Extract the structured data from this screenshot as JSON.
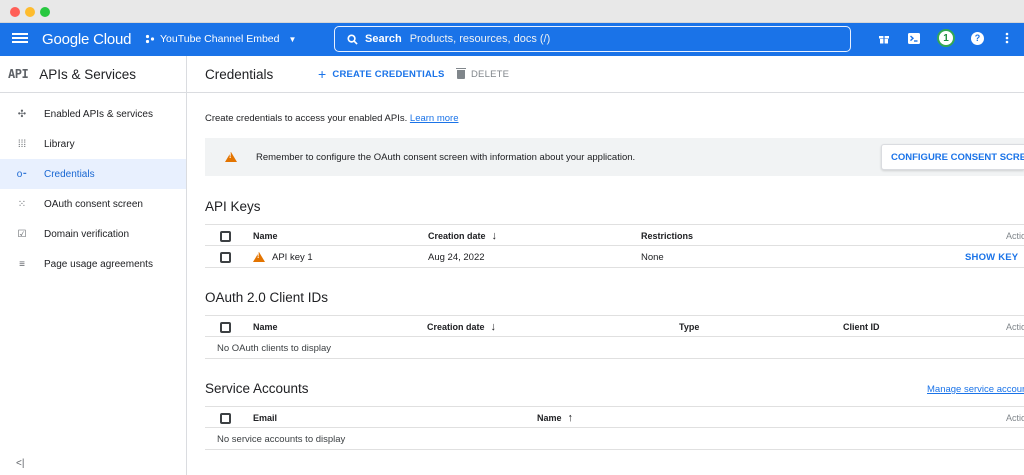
{
  "topbar": {
    "logo": "Google Cloud",
    "project": "YouTube Channel Embed",
    "search": {
      "label": "Search",
      "placeholder": "Products, resources, docs (/)"
    },
    "notification_count": "1",
    "brand_color": "#1a73e8"
  },
  "sidebar": {
    "api_badge": "API",
    "title": "APIs & Services",
    "items": [
      {
        "label": "Enabled APIs & services",
        "icon": "apis-icon"
      },
      {
        "label": "Library",
        "icon": "library-icon"
      },
      {
        "label": "Credentials",
        "icon": "key-icon",
        "active": true
      },
      {
        "label": "OAuth consent screen",
        "icon": "consent-icon"
      },
      {
        "label": "Domain verification",
        "icon": "domain-icon"
      },
      {
        "label": "Page usage agreements",
        "icon": "agreements-icon"
      }
    ],
    "collapse_glyph": "<|"
  },
  "main": {
    "title": "Credentials",
    "create_label": "CREATE CREDENTIALS",
    "delete_label": "DELETE",
    "intro_text": "Create credentials to access your enabled APIs.",
    "learn_more": "Learn more",
    "banner": {
      "message": "Remember to configure the OAuth consent screen with information about your application.",
      "button": "CONFIGURE CONSENT SCREEN"
    },
    "api_keys": {
      "title": "API Keys",
      "columns": [
        "Name",
        "Creation date",
        "Restrictions",
        "Actions"
      ],
      "rows": [
        {
          "name": "API key 1",
          "creation_date": "Aug 24, 2022",
          "restrictions": "None",
          "action": "SHOW KEY"
        }
      ]
    },
    "oauth": {
      "title": "OAuth 2.0 Client IDs",
      "columns": [
        "Name",
        "Creation date",
        "Type",
        "Client ID",
        "Actions"
      ],
      "empty": "No OAuth clients to display"
    },
    "service_accounts": {
      "title": "Service Accounts",
      "manage_link": "Manage service accounts",
      "columns": [
        "Email",
        "Name",
        "Actions"
      ],
      "empty": "No service accounts to display"
    }
  }
}
